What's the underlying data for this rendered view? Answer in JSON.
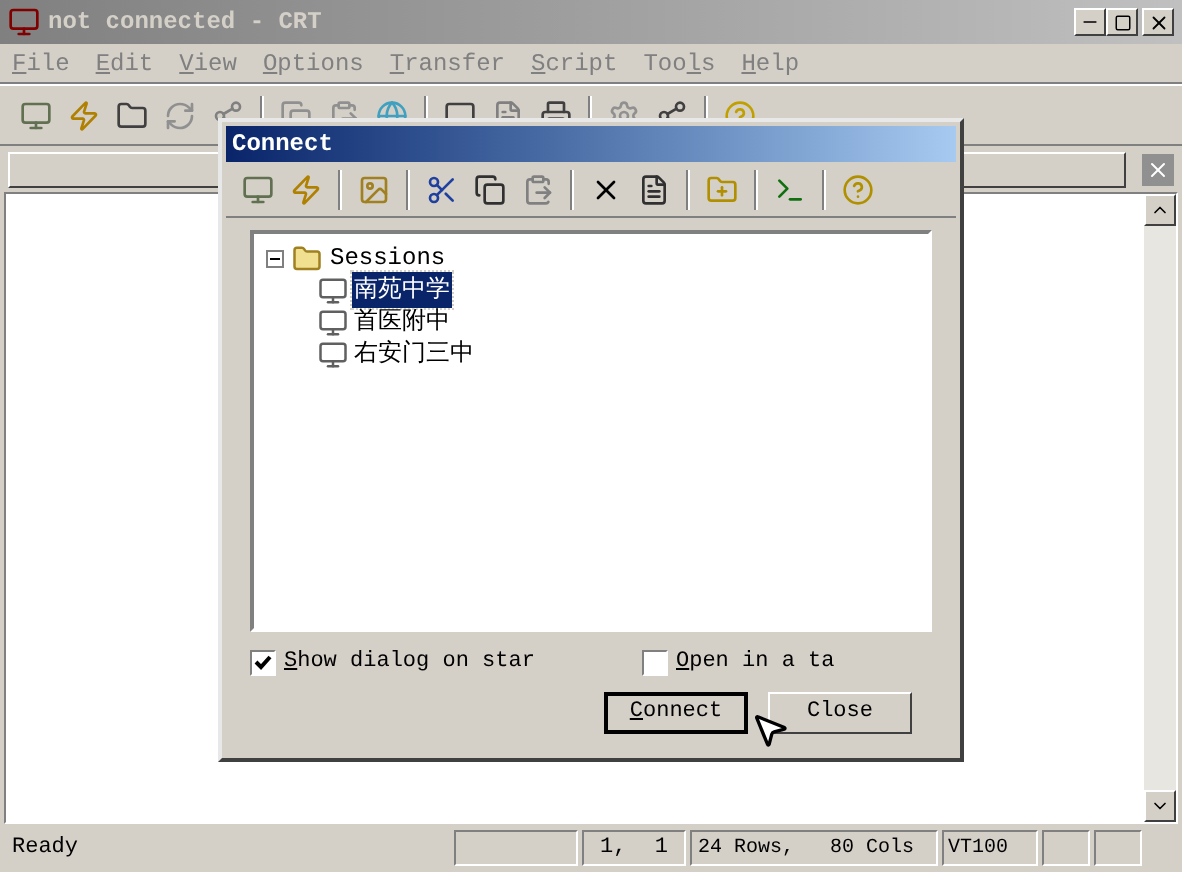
{
  "window": {
    "title": "not connected - CRT"
  },
  "menu": [
    {
      "key": "F",
      "after": "ile"
    },
    {
      "key": "E",
      "after": "dit"
    },
    {
      "key": "V",
      "after": "iew"
    },
    {
      "key": "O",
      "after": "ptions"
    },
    {
      "key": "T",
      "after": "ransfer"
    },
    {
      "key": "S",
      "after": "cript"
    },
    {
      "before": "Too",
      "key": "l",
      "after": "s"
    },
    {
      "key": "H",
      "after": "elp"
    }
  ],
  "status_bar": {
    "message": "Ready",
    "cursor_row": "1,",
    "cursor_col": "1",
    "size": "24 Rows,   80 Cols",
    "emulation": "VT100"
  },
  "dialog": {
    "title": "Connect",
    "tree": {
      "label": "Sessions",
      "expanded": true,
      "children": [
        {
          "label": "南苑中学",
          "selected": true
        },
        {
          "label": "首医附中",
          "selected": false
        },
        {
          "label": "右安门三中",
          "selected": false
        }
      ]
    },
    "checkboxes": [
      {
        "key": "S",
        "after": "how dialog on star",
        "checked": true
      },
      {
        "key": "O",
        "after": "pen in a ta",
        "checked": false
      }
    ],
    "buttons": [
      {
        "key": "C",
        "after": "onnect",
        "default": true
      },
      {
        "before": "Close",
        "default": false
      }
    ]
  }
}
